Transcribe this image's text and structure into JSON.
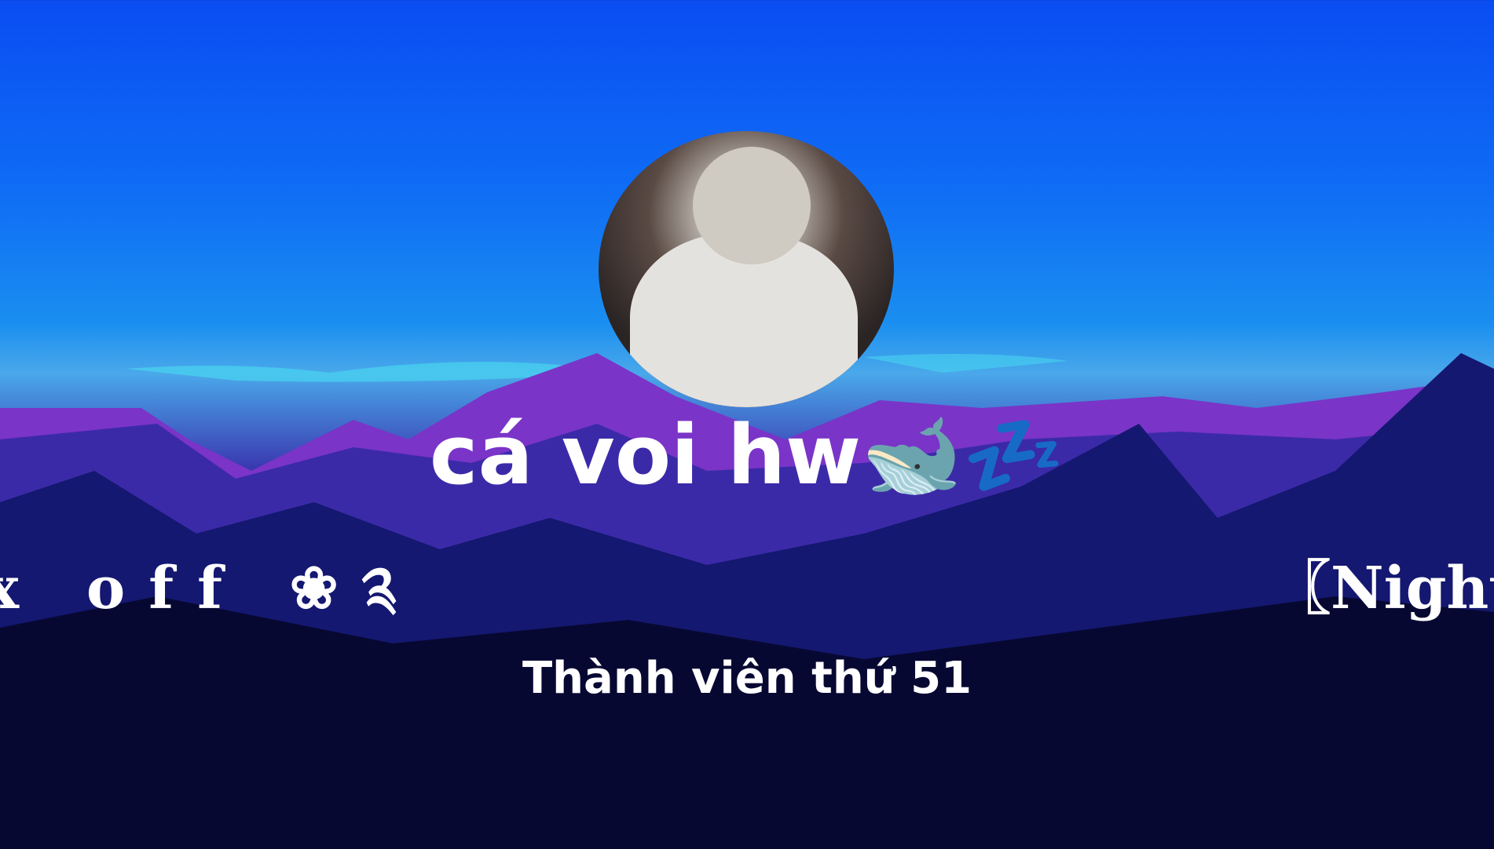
{
  "profile": {
    "display_name": "cá voi hw🐋💤",
    "member_label": "Thành viên thứ 51"
  },
  "marquee": {
    "left_fragment": "x off ❀༉",
    "right_fragment": "〖Night"
  },
  "colors": {
    "sky": "#0f6cf5",
    "mountains": "#8a3ad0",
    "forest": "#07083a",
    "text": "#ffffff"
  }
}
